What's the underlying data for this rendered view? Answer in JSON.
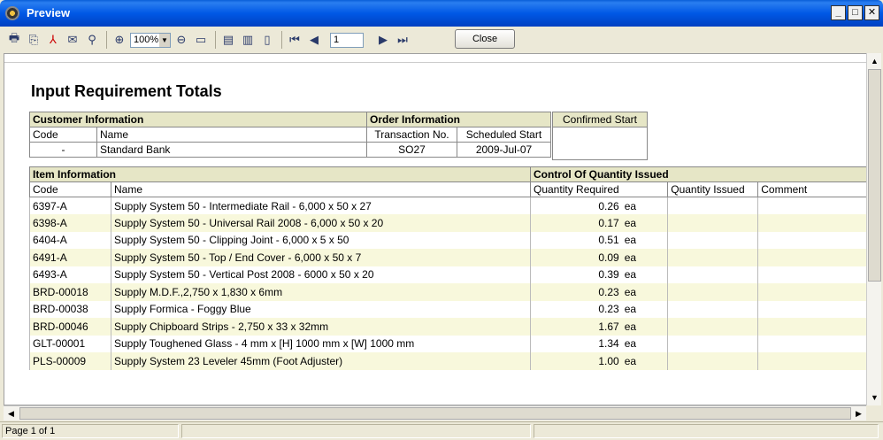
{
  "window": {
    "title": "Preview"
  },
  "toolbar": {
    "zoom": "100%",
    "page": "1",
    "close_label": "Close"
  },
  "status": {
    "page_info": "Page 1 of 1"
  },
  "report": {
    "title": "Input Requirement Totals",
    "customer": {
      "section_label": "Customer Information",
      "code_label": "Code",
      "name_label": "Name",
      "code": "-",
      "name": "Standard Bank"
    },
    "order": {
      "section_label": "Order Information",
      "txn_label": "Transaction No.",
      "start_label": "Scheduled Start",
      "txn": "SO27",
      "start": "2009-Jul-07"
    },
    "confirmed_label": "Confirmed Start",
    "items_section": "Item Information",
    "control_section": "Control Of Quantity Issued",
    "columns": {
      "code": "Code",
      "name": "Name",
      "qty_required": "Quantity Required",
      "qty_issued": "Quantity Issued",
      "comment": "Comment"
    },
    "rows": [
      {
        "code": "6397-A",
        "name": "Supply System 50 - Intermediate Rail - 6,000 x 50 x 27",
        "qty": "0.26",
        "unit": "ea"
      },
      {
        "code": "6398-A",
        "name": "Supply System 50 - Universal Rail 2008 - 6,000 x 50 x 20",
        "qty": "0.17",
        "unit": "ea"
      },
      {
        "code": "6404-A",
        "name": "Supply System 50 - Clipping Joint - 6,000 x 5 x 50",
        "qty": "0.51",
        "unit": "ea"
      },
      {
        "code": "6491-A",
        "name": "Supply System 50 - Top / End Cover - 6,000 x 50 x 7",
        "qty": "0.09",
        "unit": "ea"
      },
      {
        "code": "6493-A",
        "name": "Supply System 50 - Vertical Post 2008 - 6000 x 50 x 20",
        "qty": "0.39",
        "unit": "ea"
      },
      {
        "code": "BRD-00018",
        "name": "Supply M.D.F.,2,750 x 1,830 x 6mm",
        "qty": "0.23",
        "unit": "ea"
      },
      {
        "code": "BRD-00038",
        "name": "Supply Formica - Foggy Blue",
        "qty": "0.23",
        "unit": "ea"
      },
      {
        "code": "BRD-00046",
        "name": "Supply Chipboard Strips - 2,750 x 33 x 32mm",
        "qty": "1.67",
        "unit": "ea"
      },
      {
        "code": "GLT-00001",
        "name": "Supply Toughened Glass - 4 mm x [H] 1000 mm x [W] 1000 mm",
        "qty": "1.34",
        "unit": "ea"
      },
      {
        "code": "PLS-00009",
        "name": "Supply System 23 Leveler 45mm (Foot Adjuster)",
        "qty": "1.00",
        "unit": "ea"
      }
    ]
  }
}
